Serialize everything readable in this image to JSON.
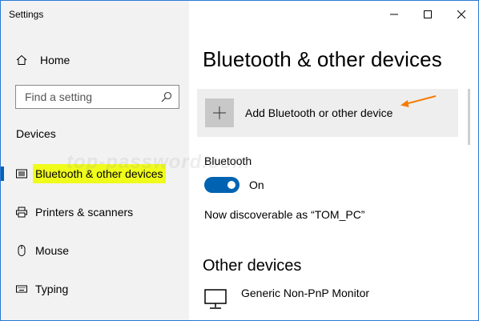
{
  "window": {
    "title": "Settings"
  },
  "sidebar": {
    "home_label": "Home",
    "search_placeholder": "Find a setting",
    "section_title": "Devices",
    "items": [
      {
        "label": "Bluetooth & other devices",
        "icon": "bluetooth-devices-icon",
        "selected": true
      },
      {
        "label": "Printers & scanners",
        "icon": "printer-icon",
        "selected": false
      },
      {
        "label": "Mouse",
        "icon": "mouse-icon",
        "selected": false
      },
      {
        "label": "Typing",
        "icon": "keyboard-icon",
        "selected": false
      }
    ]
  },
  "main": {
    "page_title": "Bluetooth & other devices",
    "add_device_label": "Add Bluetooth or other device",
    "bluetooth": {
      "label": "Bluetooth",
      "toggle_state": "On",
      "discoverable_text": "Now discoverable as “TOM_PC”"
    },
    "other_devices": {
      "title": "Other devices",
      "devices": [
        {
          "name": "Generic Non-PnP Monitor",
          "icon": "monitor-icon"
        }
      ]
    }
  },
  "watermark": "top-password.com",
  "colors": {
    "accent": "#0063b1",
    "highlight": "#f0fc1a",
    "annotation_arrow": "#f57c00",
    "sidebar_bg": "#f2f2f2"
  }
}
